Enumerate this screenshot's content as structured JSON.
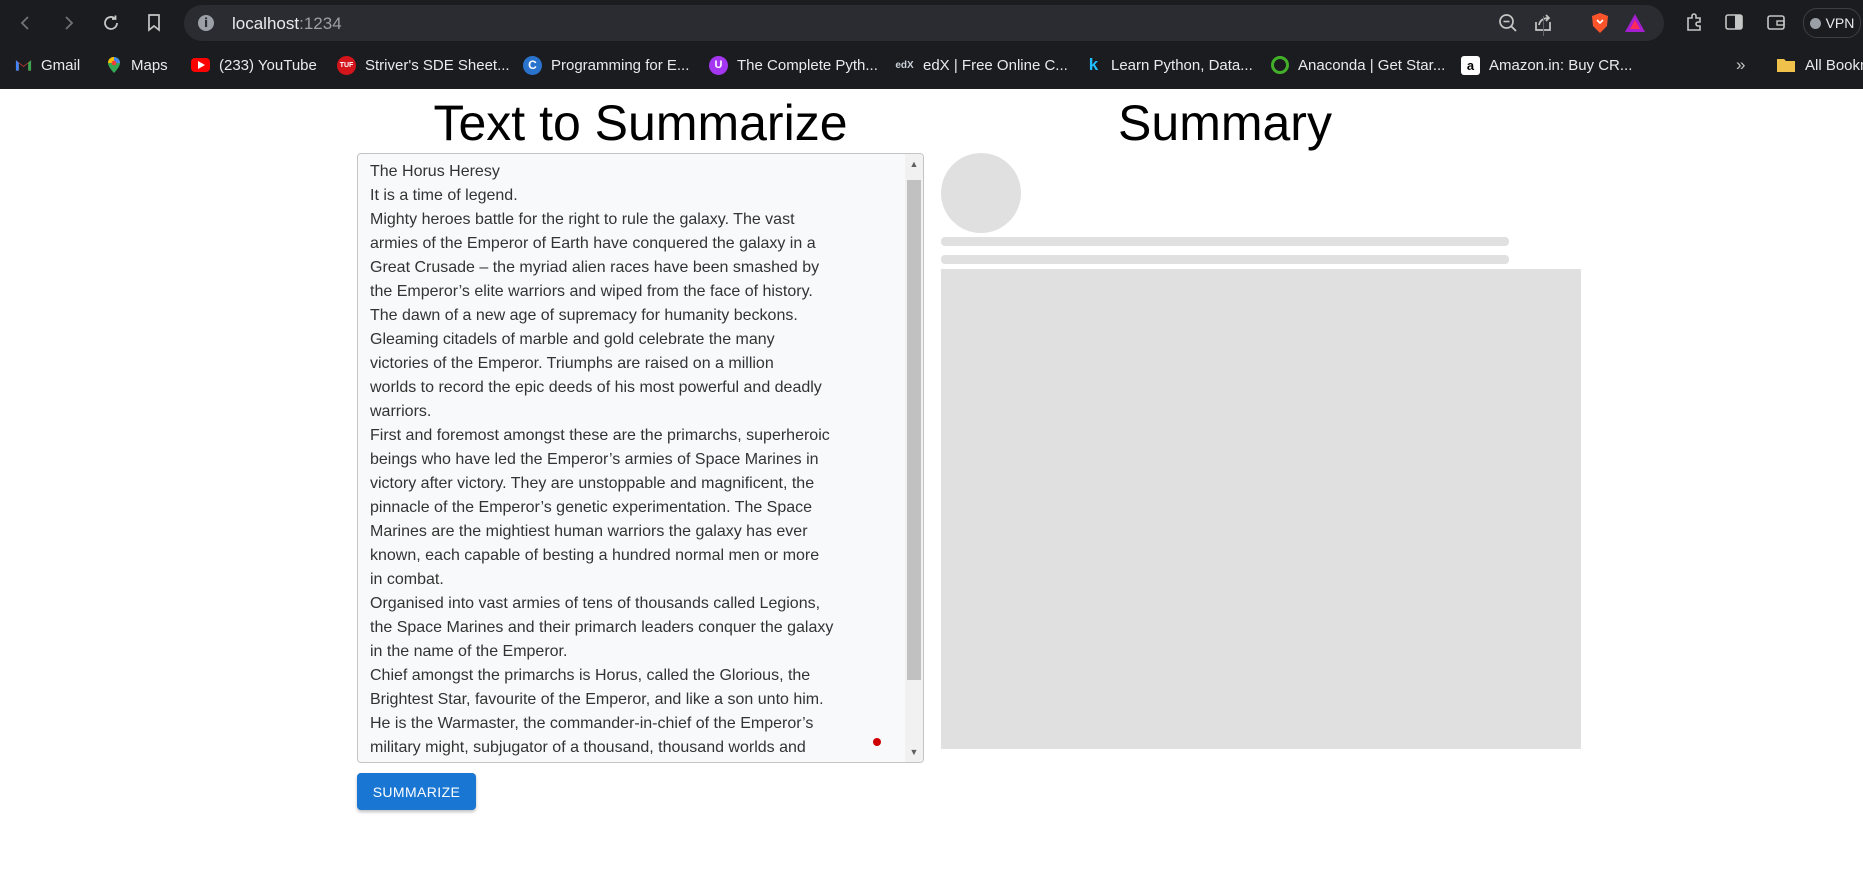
{
  "browser": {
    "url_host": "localhost",
    "url_port": ":1234",
    "vpn_label": "VPN",
    "bookmarks": [
      {
        "label": "Gmail",
        "icon": "gmail-icon"
      },
      {
        "label": "Maps",
        "icon": "maps-icon"
      },
      {
        "label": "(233) YouTube",
        "icon": "youtube-icon"
      },
      {
        "label": "Striver's SDE Sheet...",
        "icon": "tuf-icon"
      },
      {
        "label": "Programming for E...",
        "icon": "coursera-icon"
      },
      {
        "label": "The Complete Pyth...",
        "icon": "udemy-icon"
      },
      {
        "label": "edX | Free Online C...",
        "icon": "edx-icon"
      },
      {
        "label": "Learn Python, Data...",
        "icon": "kaggle-icon"
      },
      {
        "label": "Anaconda | Get Star...",
        "icon": "anaconda-icon"
      },
      {
        "label": "Amazon.in: Buy CR...",
        "icon": "amazon-icon"
      }
    ],
    "more_bookmarks": "»",
    "all_bookmarks": "All Bookm"
  },
  "page": {
    "left_title": "Text to Summarize",
    "right_title": "Summary",
    "input_text": "The Horus Heresy\nIt is a time of legend.\nMighty heroes battle for the right to rule the galaxy. The vast\narmies of the Emperor of Earth have conquered the galaxy in a\nGreat Crusade – the myriad alien races have been smashed by\nthe Emperor’s elite warriors and wiped from the face of history.\nThe dawn of a new age of supremacy for humanity beckons.\nGleaming citadels of marble and gold celebrate the many\nvictories of the Emperor. Triumphs are raised on a million\nworlds to record the epic deeds of his most powerful and deadly\nwarriors.\nFirst and foremost amongst these are the primarchs, superheroic\nbeings who have led the Emperor’s armies of Space Marines in\nvictory after victory. They are unstoppable and magnificent, the\npinnacle of the Emperor’s genetic experimentation. The Space\nMarines are the mightiest human warriors the galaxy has ever\nknown, each capable of besting a hundred normal men or more\nin combat.\nOrganised into vast armies of tens of thousands called Legions,\nthe Space Marines and their primarch leaders conquer the galaxy\nin the name of the Emperor.\nChief amongst the primarchs is Horus, called the Glorious, the\nBrightest Star, favourite of the Emperor, and like a son unto him.\nHe is the Warmaster, the commander-in-chief of the Emperor’s\nmilitary might, subjugator of a thousand, thousand worlds and",
    "summarize_label": "SUMMARIZE"
  },
  "colors": {
    "button": "#1976d2",
    "skeleton": "#e0e0e0",
    "chrome": "#1b1c1f"
  }
}
